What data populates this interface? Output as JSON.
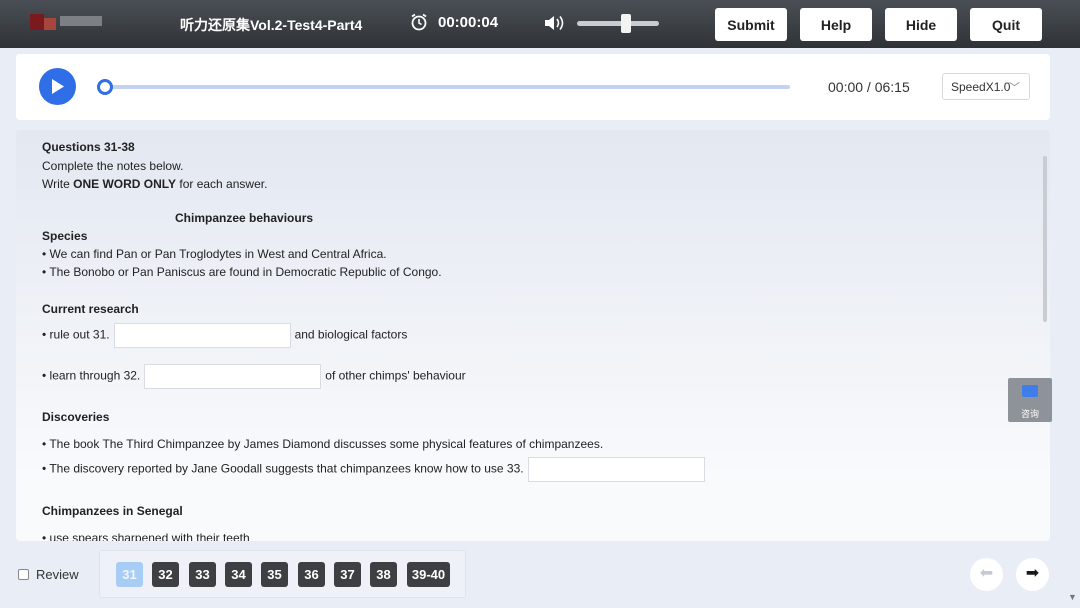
{
  "header": {
    "title": "听力还原集Vol.2-Test4-Part4",
    "timer": "00:00:04",
    "buttons": {
      "submit": "Submit",
      "help": "Help",
      "hide": "Hide",
      "quit": "Quit"
    },
    "volume_level": 0.6
  },
  "player": {
    "time": "00:00 / 06:15",
    "speed": "SpeedX1.0",
    "progress": 0
  },
  "questions": {
    "heading": "Questions 31-38",
    "instruction1": "Complete the notes below.",
    "instruction2_pre": "Write ",
    "instruction2_bold": "ONE WORD ONLY",
    "instruction2_post": " for each answer.",
    "notes_title": "Chimpanzee behaviours",
    "species_heading": "Species",
    "species_1": "• We can find Pan or Pan Troglodytes in West and Central Africa.",
    "species_2": "• The Bonobo or Pan Paniscus are found in Democratic Republic of Congo.",
    "research_heading": "Current research",
    "q31_pre": "• rule out 31.",
    "q31_post": "and biological factors",
    "q32_pre": "• learn through 32.",
    "q32_post": "of other chimps' behaviour",
    "discoveries_heading": "Discoveries",
    "disc_1": "• The book The Third Chimpanzee by James Diamond discusses some physical features of chimpanzees.",
    "disc_2_pre": "• The discovery reported by Jane Goodall suggests that chimpanzees know how to use 33.",
    "senegal_heading": "Chimpanzees in Senegal",
    "senegal_1": "• use spears sharpened with their teeth"
  },
  "consult": {
    "label": "咨询"
  },
  "footer": {
    "review_label": "Review",
    "question_buttons": [
      "31",
      "32",
      "33",
      "34",
      "35",
      "36",
      "37",
      "38",
      "39-40"
    ],
    "active_question": "31"
  }
}
